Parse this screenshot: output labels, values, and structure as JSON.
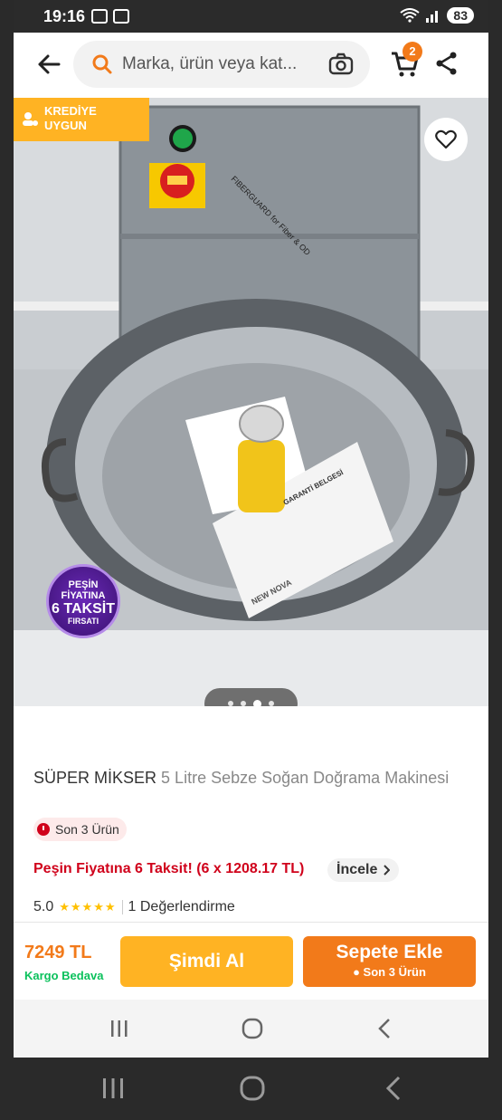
{
  "status_bar": {
    "time": "19:16",
    "battery": "83"
  },
  "search": {
    "placeholder": "Marka, ürün veya kat..."
  },
  "cart": {
    "badge": "2"
  },
  "gallery": {
    "credit_badge_line1": "KREDİYE",
    "credit_badge_line2": "UYGUN",
    "promo_line1": "PEŞİN",
    "promo_line2": "FİYATINA",
    "promo_line3": "6 TAKSİT",
    "promo_line4": "FIRSATI",
    "page_indicator": {
      "count": 4,
      "active": 3
    }
  },
  "product": {
    "brand": "SÜPER MİKSER",
    "name": "5 Litre Sebze Soğan Doğrama Makinesi",
    "stock_label": "Son 3 Ürün",
    "installment_text": "Peşin Fiyatına 6 Taksit! (6 x 1208.17 TL)",
    "review_link": "İncele",
    "rating_value": "5.0",
    "rating_stars": 5,
    "review_count": "1 Değerlendirme"
  },
  "purchase": {
    "price": "7249 TL",
    "shipping": "Kargo Bedava",
    "buy_now": "Şimdi Al",
    "add_to_cart": "Sepete Ekle",
    "add_to_cart_sub": "● Son 3 Ürün"
  },
  "colors": {
    "accent": "#f27a1a",
    "yellow": "#ffb323",
    "red": "#d0021b",
    "green": "#0bc15c"
  }
}
